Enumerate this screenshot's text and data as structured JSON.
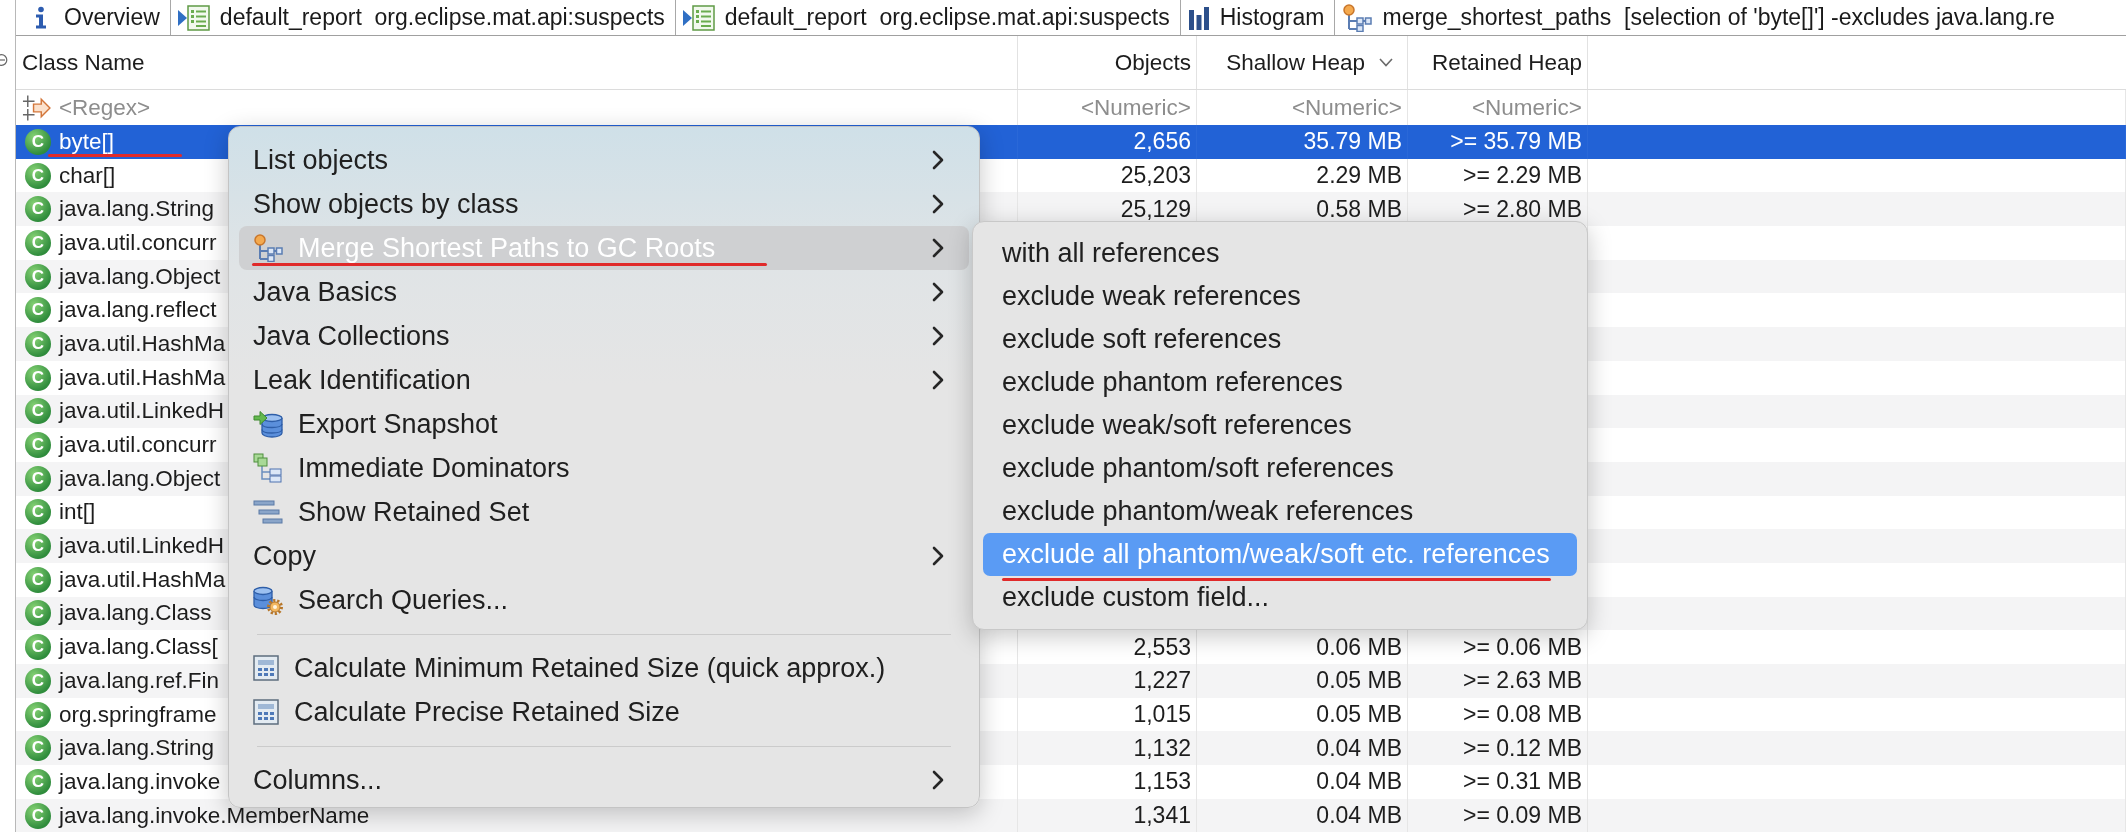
{
  "tabs": [
    {
      "kind": "overview",
      "label": "Overview"
    },
    {
      "kind": "report",
      "label": "default_report  org.eclipse.mat.api:suspects"
    },
    {
      "kind": "report",
      "label": "default_report  org.eclipse.mat.api:suspects"
    },
    {
      "kind": "histogram",
      "label": "Histogram"
    },
    {
      "kind": "paths",
      "label": "merge_shortest_paths  [selection of 'byte[]'] -excludes java.lang.re"
    }
  ],
  "table": {
    "columns": [
      {
        "label": "Class Name",
        "sorted": false
      },
      {
        "label": "Objects",
        "sorted": false
      },
      {
        "label": "Shallow Heap",
        "sorted": true
      },
      {
        "label": "Retained Heap",
        "sorted": false
      }
    ],
    "filter_row": [
      {
        "placeholder": "<Regex>"
      },
      {
        "placeholder": "<Numeric>"
      },
      {
        "placeholder": "<Numeric>"
      },
      {
        "placeholder": "<Numeric>"
      }
    ],
    "rows": [
      {
        "badge": "C",
        "class_name": "byte[]",
        "objects": "2,656",
        "shallow_heap": "35.79 MB",
        "retained_heap": ">= 35.79 MB",
        "selected": true,
        "underlined": true
      },
      {
        "badge": "C",
        "class_name": "char[]",
        "objects": "25,203",
        "shallow_heap": "2.29 MB",
        "retained_heap": ">= 2.29 MB",
        "selected": false,
        "underlined": false
      },
      {
        "badge": "C",
        "class_name": "java.lang.String",
        "objects": "25,129",
        "shallow_heap": "0.58 MB",
        "retained_heap": ">= 2.80 MB",
        "selected": false,
        "underlined": false
      },
      {
        "badge": "C",
        "class_name": "java.util.concurr",
        "selected": false,
        "underlined": false
      },
      {
        "badge": "C",
        "class_name": "java.lang.Object",
        "selected": false,
        "underlined": false
      },
      {
        "badge": "C",
        "class_name": "java.lang.reflect",
        "selected": false,
        "underlined": false
      },
      {
        "badge": "C",
        "class_name": "java.util.HashMa",
        "selected": false,
        "underlined": false
      },
      {
        "badge": "C",
        "class_name": "java.util.HashMa",
        "selected": false,
        "underlined": false
      },
      {
        "badge": "C",
        "class_name": "java.util.LinkedH",
        "selected": false,
        "underlined": false
      },
      {
        "badge": "C",
        "class_name": "java.util.concurr",
        "selected": false,
        "underlined": false
      },
      {
        "badge": "C",
        "class_name": "java.lang.Object",
        "selected": false,
        "underlined": false
      },
      {
        "badge": "C",
        "class_name": "int[]",
        "selected": false,
        "underlined": false
      },
      {
        "badge": "C",
        "class_name": "java.util.LinkedH",
        "selected": false,
        "underlined": false
      },
      {
        "badge": "C",
        "class_name": "java.util.HashMa",
        "selected": false,
        "underlined": false
      },
      {
        "badge": "C",
        "class_name": "java.lang.Class",
        "selected": false,
        "underlined": false
      },
      {
        "badge": "C",
        "class_name": "java.lang.Class[",
        "objects": "2,553",
        "shallow_heap": "0.06 MB",
        "retained_heap": ">= 0.06 MB",
        "selected": false,
        "underlined": false
      },
      {
        "badge": "C",
        "class_name": "java.lang.ref.Fin",
        "objects": "1,227",
        "shallow_heap": "0.05 MB",
        "retained_heap": ">= 2.63 MB",
        "selected": false,
        "underlined": false
      },
      {
        "badge": "C",
        "class_name": "org.springframe",
        "objects": "1,015",
        "shallow_heap": "0.05 MB",
        "retained_heap": ">= 0.08 MB",
        "selected": false,
        "underlined": false
      },
      {
        "badge": "C",
        "class_name": "java.lang.String",
        "objects": "1,132",
        "shallow_heap": "0.04 MB",
        "retained_heap": ">= 0.12 MB",
        "selected": false,
        "underlined": false
      },
      {
        "badge": "C",
        "class_name": "java.lang.invoke",
        "objects": "1,153",
        "shallow_heap": "0.04 MB",
        "retained_heap": ">= 0.31 MB",
        "selected": false,
        "underlined": false
      },
      {
        "badge": "C",
        "class_name": "java.lang.invoke.MemberName",
        "objects": "1,341",
        "shallow_heap": "0.04 MB",
        "retained_heap": ">= 0.09 MB",
        "selected": false,
        "underlined": false
      }
    ]
  },
  "context_menu": {
    "items": [
      {
        "kind": "plain",
        "label": "List objects",
        "submenu": true,
        "selected": false,
        "underlined": false
      },
      {
        "kind": "plain",
        "label": "Show objects by class",
        "submenu": true,
        "selected": false,
        "underlined": false
      },
      {
        "kind": "merge",
        "label": "Merge Shortest Paths to GC Roots",
        "submenu": true,
        "selected": true,
        "underlined": true
      },
      {
        "kind": "plain",
        "label": "Java Basics",
        "submenu": true,
        "selected": false,
        "underlined": false
      },
      {
        "kind": "plain",
        "label": "Java Collections",
        "submenu": true,
        "selected": false,
        "underlined": false
      },
      {
        "kind": "plain",
        "label": "Leak Identification",
        "submenu": true,
        "selected": false,
        "underlined": false
      },
      {
        "kind": "export",
        "label": "Export Snapshot",
        "submenu": false,
        "selected": false,
        "underlined": false
      },
      {
        "kind": "dominators",
        "label": "Immediate Dominators",
        "submenu": false,
        "selected": false,
        "underlined": false
      },
      {
        "kind": "retained_set",
        "label": "Show Retained Set",
        "submenu": false,
        "selected": false,
        "underlined": false
      },
      {
        "kind": "plain",
        "label": "Copy",
        "submenu": true,
        "selected": false,
        "underlined": false
      },
      {
        "kind": "queries",
        "label": "Search Queries...",
        "submenu": false,
        "selected": false,
        "underlined": false
      },
      {
        "kind": "separator"
      },
      {
        "kind": "calculate",
        "label": "Calculate Minimum Retained Size (quick approx.)",
        "submenu": false,
        "selected": false,
        "underlined": false
      },
      {
        "kind": "calculate",
        "label": "Calculate Precise Retained Size",
        "submenu": false,
        "selected": false,
        "underlined": false
      },
      {
        "kind": "separator"
      },
      {
        "kind": "plain",
        "label": "Columns...",
        "submenu": true,
        "selected": false,
        "underlined": false
      }
    ]
  },
  "submenu": {
    "items": [
      {
        "label": "with all references",
        "selected": false,
        "underlined": false
      },
      {
        "label": "exclude weak references",
        "selected": false,
        "underlined": false
      },
      {
        "label": "exclude soft references",
        "selected": false,
        "underlined": false
      },
      {
        "label": "exclude phantom references",
        "selected": false,
        "underlined": false
      },
      {
        "label": "exclude weak/soft references",
        "selected": false,
        "underlined": false
      },
      {
        "label": "exclude phantom/soft references",
        "selected": false,
        "underlined": false
      },
      {
        "label": "exclude phantom/weak references",
        "selected": false,
        "underlined": false
      },
      {
        "label": "exclude all phantom/weak/soft etc. references",
        "selected": true,
        "underlined": true
      },
      {
        "label": "exclude custom field...",
        "selected": false,
        "underlined": false
      }
    ]
  }
}
